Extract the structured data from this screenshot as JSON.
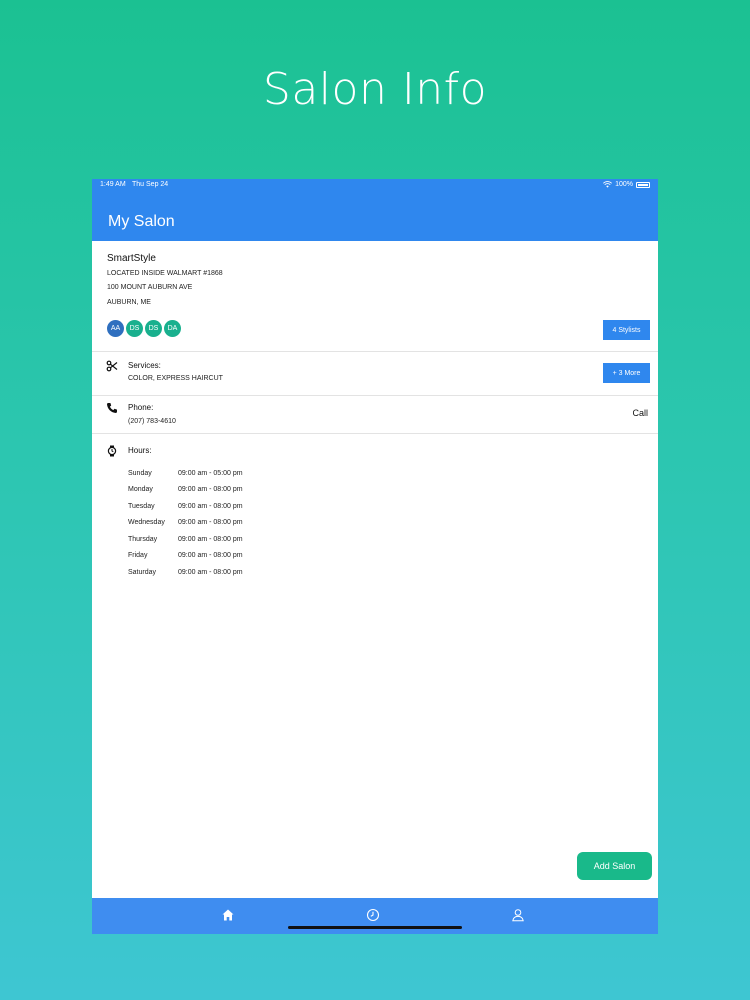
{
  "promo": {
    "title": "Salon Info"
  },
  "status_bar": {
    "time": "1:49 AM",
    "date": "Thu Sep 24",
    "battery": "100%"
  },
  "nav": {
    "title": "My Salon"
  },
  "salon": {
    "name": "SmartStyle",
    "address_lines": [
      "LOCATED INSIDE WALMART #1868",
      "100 MOUNT AUBURN AVE",
      "AUBURN, ME"
    ],
    "stylists": [
      {
        "initials": "AA",
        "color": "#2f6fbf"
      },
      {
        "initials": "DS",
        "color": "#19b08e"
      },
      {
        "initials": "DS",
        "color": "#19b08e"
      },
      {
        "initials": "DA",
        "color": "#19b08e"
      }
    ],
    "stylists_button": "4 Stylists"
  },
  "services": {
    "label": "Services:",
    "value": "COLOR, EXPRESS HAIRCUT",
    "more_button": "+ 3 More"
  },
  "phone": {
    "label": "Phone:",
    "value": "(207) 783-4610",
    "call": "Call"
  },
  "hours": {
    "label": "Hours:",
    "days": [
      {
        "day": "Sunday",
        "time": "09:00 am - 05:00 pm"
      },
      {
        "day": "Monday",
        "time": "09:00 am - 08:00 pm"
      },
      {
        "day": "Tuesday",
        "time": "09:00 am - 08:00 pm"
      },
      {
        "day": "Wednesday",
        "time": "09:00 am - 08:00 pm"
      },
      {
        "day": "Thursday",
        "time": "09:00 am - 08:00 pm"
      },
      {
        "day": "Friday",
        "time": "09:00 am - 08:00 pm"
      },
      {
        "day": "Saturday",
        "time": "09:00 am - 08:00 pm"
      }
    ]
  },
  "add_salon_button": "Add Salon",
  "tabs": [
    {
      "icon": "home-icon"
    },
    {
      "icon": "clock-icon"
    },
    {
      "icon": "profile-icon"
    }
  ],
  "colors": {
    "primary": "#2f87ee",
    "accent": "#19b98a"
  }
}
